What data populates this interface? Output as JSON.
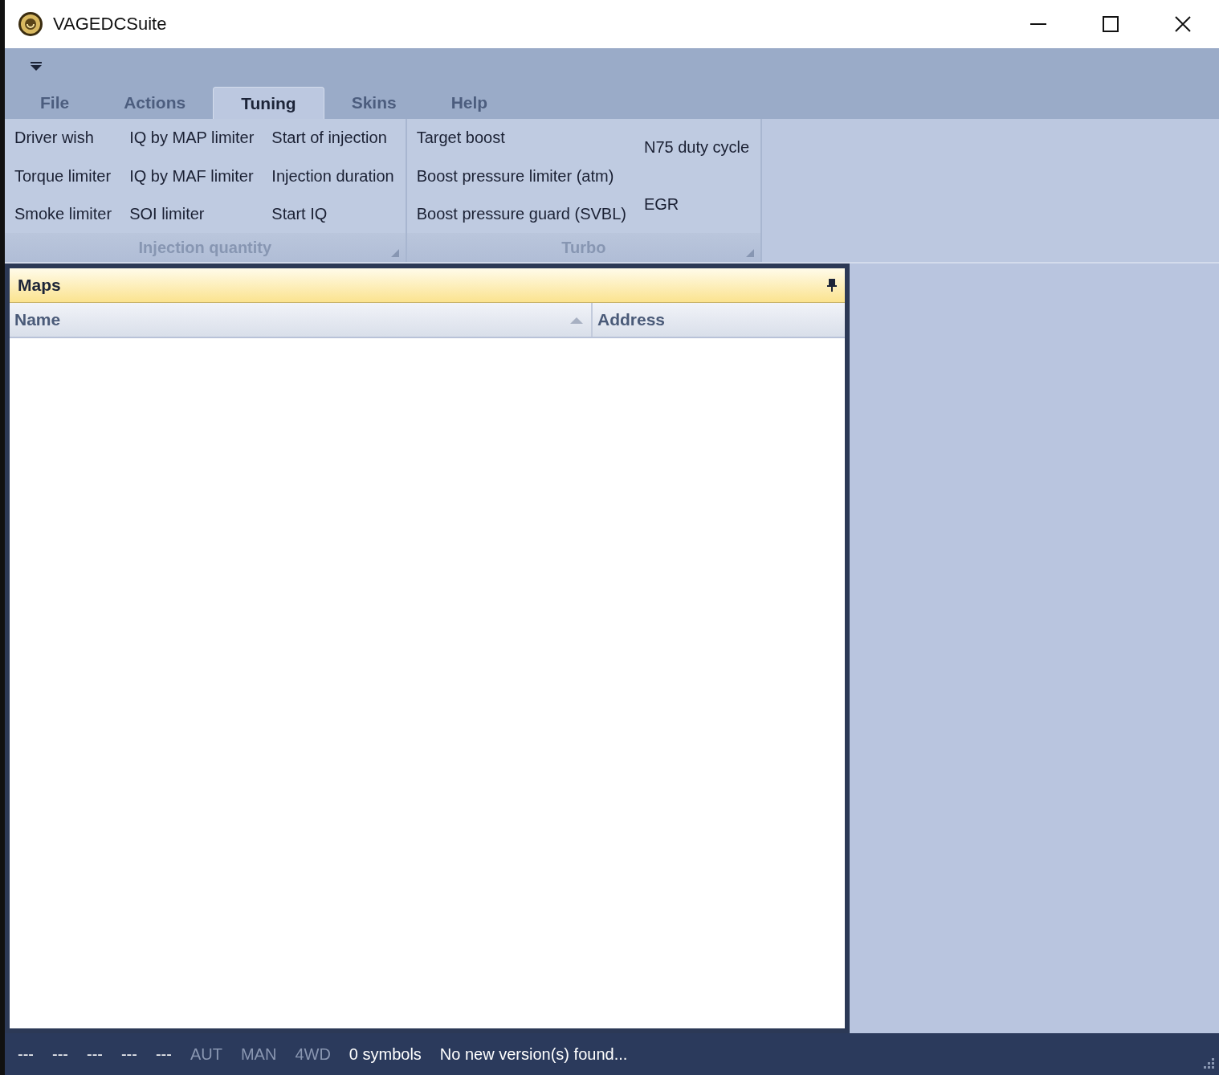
{
  "window": {
    "title": "VAGEDCSuite"
  },
  "ribbon": {
    "tabs": [
      {
        "label": "File",
        "selected": false
      },
      {
        "label": "Actions",
        "selected": false
      },
      {
        "label": "Tuning",
        "selected": true
      },
      {
        "label": "Skins",
        "selected": false
      },
      {
        "label": "Help",
        "selected": false
      }
    ],
    "groups": [
      {
        "title": "Injection quantity",
        "columns": [
          [
            "Driver wish",
            "Torque limiter",
            "Smoke limiter"
          ],
          [
            "IQ by MAP limiter",
            "IQ by MAF limiter",
            "SOI limiter"
          ],
          [
            "Start of injection",
            "Injection duration",
            "Start IQ"
          ]
        ]
      },
      {
        "title": "Turbo",
        "columns": [
          [
            "Target boost",
            "Boost pressure limiter (atm)",
            "Boost pressure guard (SVBL)"
          ],
          [
            "N75 duty cycle",
            "EGR"
          ]
        ]
      }
    ]
  },
  "maps_panel": {
    "title": "Maps",
    "columns": [
      {
        "label": "Name",
        "sorted": true
      },
      {
        "label": "Address",
        "sorted": false
      }
    ]
  },
  "status_bar": {
    "items": [
      {
        "text": "---",
        "disabled": false
      },
      {
        "text": "---",
        "disabled": false
      },
      {
        "text": "---",
        "disabled": false
      },
      {
        "text": "---",
        "disabled": false
      },
      {
        "text": "---",
        "disabled": false
      },
      {
        "text": "AUT",
        "disabled": true
      },
      {
        "text": "MAN",
        "disabled": true
      },
      {
        "text": "4WD",
        "disabled": true
      },
      {
        "text": "0 symbols",
        "disabled": false
      },
      {
        "text": "No new version(s) found...",
        "disabled": false
      }
    ]
  }
}
